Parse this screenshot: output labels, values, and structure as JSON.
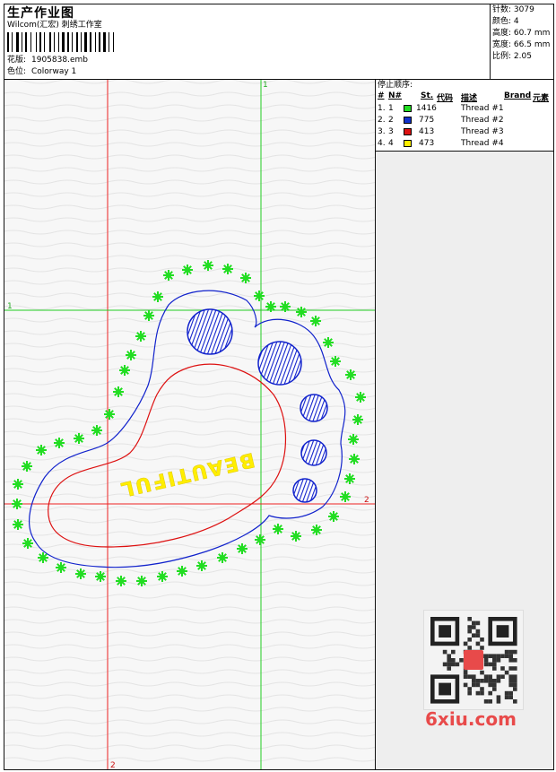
{
  "header": {
    "title": "生产作业图",
    "company": "Wilcom(汇宏) 刺绣工作室",
    "design_label": "花版:",
    "design_value": "1905838.emb",
    "colorway_label": "色位:",
    "colorway_value": "Colorway 1"
  },
  "stats": [
    {
      "label": "针数:",
      "value": "3079"
    },
    {
      "label": "颜色:",
      "value": "4"
    },
    {
      "label": "高度:",
      "value": "60.7 mm"
    },
    {
      "label": "宽度:",
      "value": "66.5 mm"
    },
    {
      "label": "比例:",
      "value": "2.05"
    }
  ],
  "stop_table": {
    "title": "停止顺序:",
    "headers": [
      "#",
      "N#",
      "St.",
      "代码",
      "描述",
      "Brand",
      "元素"
    ],
    "rows": [
      {
        "num": "1.",
        "n": "1",
        "color": "#22dd22",
        "stitches": "1416",
        "desc": "Thread #1"
      },
      {
        "num": "2.",
        "n": "2",
        "color": "#1133cc",
        "stitches": "775",
        "desc": "Thread #2"
      },
      {
        "num": "3.",
        "n": "3",
        "color": "#dd1111",
        "stitches": "413",
        "desc": "Thread #3"
      },
      {
        "num": "4.",
        "n": "4",
        "color": "#ffee00",
        "stitches": "473",
        "desc": "Thread #4"
      }
    ]
  },
  "guides": {
    "v_red_label": "2",
    "v_green_label": "1",
    "h_green_label": "1",
    "h_red_label": "2"
  },
  "design": {
    "text": "BEAUTIFUL",
    "colors": {
      "green": "#22dd22",
      "blue": "#1122cc",
      "red": "#dd1111",
      "yellow": "#ffee00"
    }
  },
  "watermark": {
    "text": "6xiu.com"
  }
}
